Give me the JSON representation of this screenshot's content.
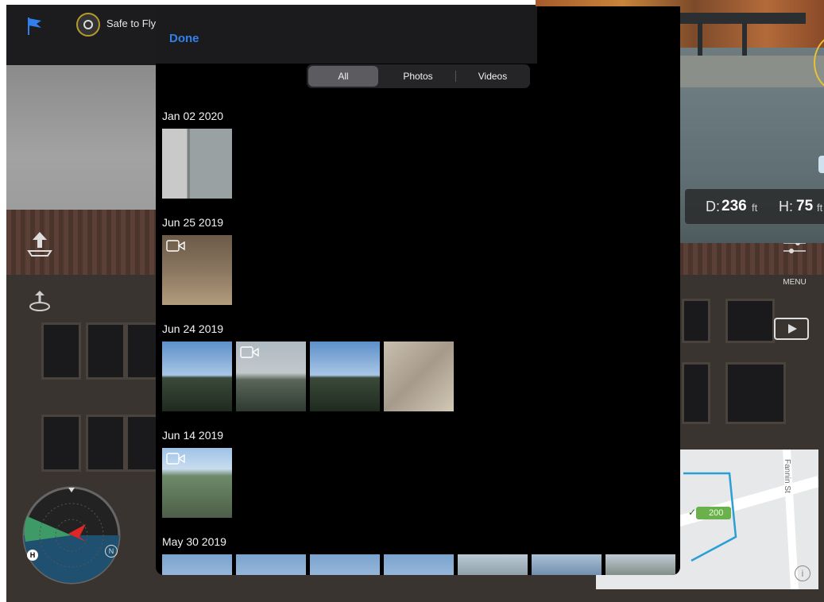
{
  "app": {
    "status_text": "Safe to Fly",
    "top_right_glyph": "○○",
    "menu_label": "MENU",
    "map": {
      "street": "Fannin St",
      "badge": "200",
      "check": "✓"
    },
    "info_glyph": "i",
    "icons": [
      "flag-icon",
      "aircraft-status-icon",
      "takeoff-icon",
      "return-home-icon",
      "settings-sliders-icon",
      "playback-icon",
      "compass-icon",
      "info-icon"
    ]
  },
  "telemetry": {
    "distance_label": "D:",
    "distance_value": "236",
    "distance_unit": "ft",
    "height_label": "H:",
    "height_value": "75",
    "height_unit": "ft"
  },
  "compass": {
    "north": "N",
    "home": "H"
  },
  "picker": {
    "done_label": "Done",
    "filters": [
      {
        "label": "All",
        "active": true
      },
      {
        "label": "Photos",
        "active": false
      },
      {
        "label": "Videos",
        "active": false
      }
    ],
    "sections": [
      {
        "date": "Jan 02 2020",
        "items": [
          {
            "kind": "photo",
            "scene": "building"
          }
        ]
      },
      {
        "date": "Jun 25 2019",
        "items": [
          {
            "kind": "video",
            "scene": "office"
          }
        ]
      },
      {
        "date": "Jun 24 2019",
        "items": [
          {
            "kind": "photo",
            "scene": "sky-trees"
          },
          {
            "kind": "video",
            "scene": "haze-trees"
          },
          {
            "kind": "photo",
            "scene": "sky-trees"
          },
          {
            "kind": "photo",
            "scene": "ground"
          }
        ]
      },
      {
        "date": "Jun 14 2019",
        "items": [
          {
            "kind": "video",
            "scene": "aerial-town"
          }
        ]
      },
      {
        "date": "May 30 2019",
        "items": [
          {
            "kind": "photo",
            "scene": "sky"
          },
          {
            "kind": "photo",
            "scene": "sky"
          },
          {
            "kind": "photo",
            "scene": "sky"
          },
          {
            "kind": "photo",
            "scene": "sky"
          },
          {
            "kind": "photo",
            "scene": "treeline"
          },
          {
            "kind": "photo",
            "scene": "bay"
          },
          {
            "kind": "photo",
            "scene": "hill"
          }
        ]
      }
    ]
  }
}
